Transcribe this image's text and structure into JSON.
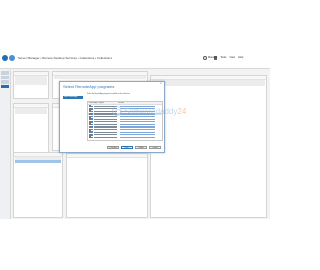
{
  "title_bar": {
    "breadcrumb": "Server Manager • Remote Desktop Services • Collections • Collection1",
    "menu": [
      "Manage",
      "Tools",
      "View",
      "Help"
    ]
  },
  "dialog": {
    "title": "Select RemoteApp programs",
    "step": "Select RemoteApp programs",
    "description": "Select the RemoteApp programs to publish on the collection.",
    "list_header": [
      "RemoteApp Program",
      "Location"
    ],
    "buttons": [
      "< Previous",
      "Next >",
      "Publish",
      "Cancel"
    ]
  },
  "watermark": {
    "text_a": "Softwaredaddy",
    "text_b": "24"
  },
  "colors": {
    "accent": "#2e75b6",
    "titlebar_bg": "#ffffff",
    "workspace_bg": "#f3f3f3",
    "watermark_blue": "#8fb3dc",
    "watermark_orange": "#e7a36b"
  }
}
